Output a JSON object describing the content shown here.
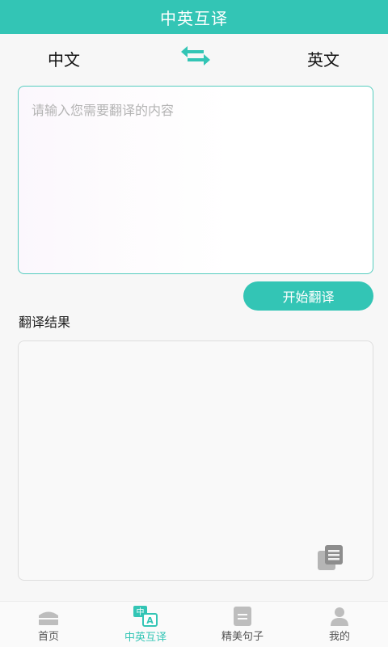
{
  "header": {
    "title": "中英互译"
  },
  "languages": {
    "from": "中文",
    "to": "英文",
    "swap_icon": "swap-arrows-icon"
  },
  "input": {
    "placeholder": "请输入您需要翻译的内容",
    "value": ""
  },
  "actions": {
    "translate_label": "开始翻译"
  },
  "result": {
    "label": "翻译结果",
    "copy_icon": "copy-document-icon"
  },
  "bottom_nav": {
    "items": [
      {
        "label": "首页",
        "icon": "home-icon",
        "active": false
      },
      {
        "label": "中英互译",
        "icon": "translate-icon",
        "active": true
      },
      {
        "label": "精美句子",
        "icon": "notes-icon",
        "active": false
      },
      {
        "label": "我的",
        "icon": "user-icon",
        "active": false
      }
    ]
  },
  "colors": {
    "accent": "#33c5b5",
    "icon_gray": "#bdbdbd"
  }
}
